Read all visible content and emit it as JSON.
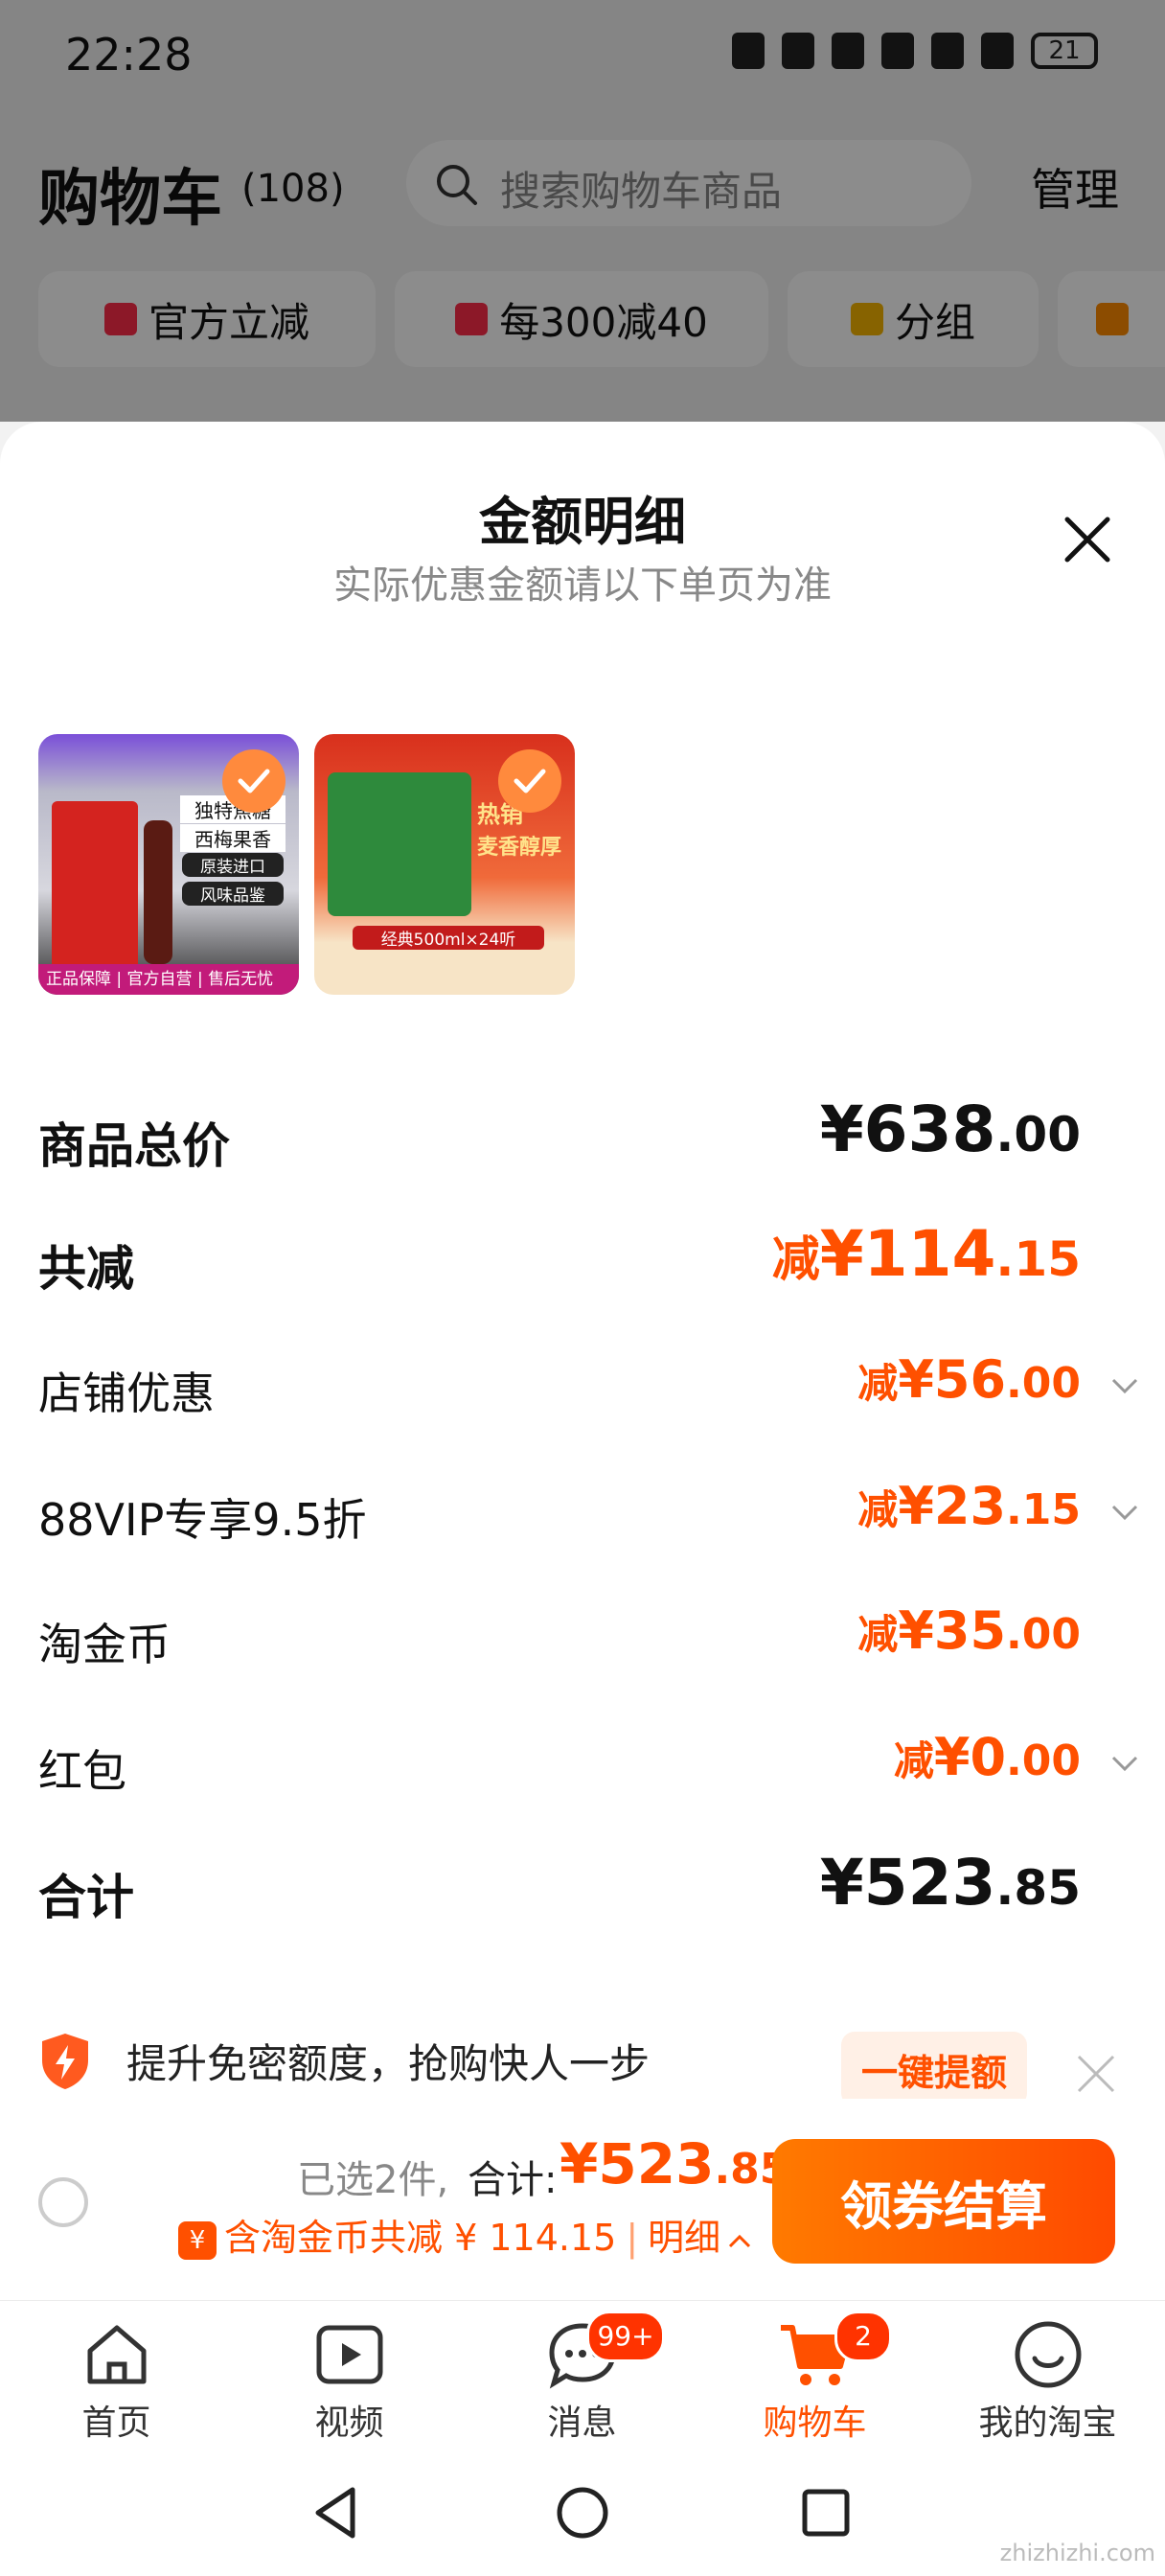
{
  "status_bar": {
    "time": "22:28",
    "battery": "21"
  },
  "header": {
    "title": "购物车",
    "count": "(108)",
    "search_placeholder": "搜索购物车商品",
    "manage": "管理"
  },
  "chips": [
    {
      "label": "官方立减",
      "icon": "lightning-icon"
    },
    {
      "label": "每300减40",
      "icon": "coupon-icon"
    },
    {
      "label": "分组",
      "icon": "folder-icon"
    }
  ],
  "sheet": {
    "title": "金额明细",
    "subtitle": "实际优惠金额请以下单页为准",
    "products": [
      {
        "name": "hennessy-product",
        "tags": [
          "独特焦糖",
          "西梅果香",
          "原装进口",
          "风味品鉴"
        ],
        "footer": "正品保障 | 官方自营 | 售后无忧"
      },
      {
        "name": "tsingtao-product",
        "tags": [
          "热销",
          "麦香醇厚"
        ],
        "footer": "经典500ml×24听"
      }
    ],
    "rows": [
      {
        "label": "商品总价",
        "prefix": "",
        "int": "¥638",
        "dec": ".00",
        "emph": true,
        "orange": false,
        "chevron": false
      },
      {
        "label": "共减",
        "prefix": "减",
        "int": "¥114",
        "dec": ".15",
        "emph": true,
        "orange": true,
        "chevron": false
      },
      {
        "label": "店铺优惠",
        "prefix": "减",
        "int": "¥56",
        "dec": ".00",
        "emph": false,
        "orange": true,
        "chevron": true
      },
      {
        "label": "88VIP专享9.5折",
        "prefix": "减",
        "int": "¥23",
        "dec": ".15",
        "emph": false,
        "orange": true,
        "chevron": true
      },
      {
        "label": "淘金币",
        "prefix": "减",
        "int": "¥35",
        "dec": ".00",
        "emph": false,
        "orange": true,
        "chevron": false
      },
      {
        "label": "红包",
        "prefix": "减",
        "int": "¥0",
        "dec": ".00",
        "emph": false,
        "orange": true,
        "chevron": true
      },
      {
        "label": "合计",
        "prefix": "",
        "int": "¥523",
        "dec": ".85",
        "emph": true,
        "orange": false,
        "chevron": false
      }
    ],
    "tip": {
      "text": "提升免密额度，抢购快人一步",
      "button": "一键提额"
    }
  },
  "checkout": {
    "selected": "已选2件,",
    "total_label": "合计:",
    "total_int": "¥523",
    "total_dec": ".85",
    "promo": "含淘金币共减 ¥ 114.15",
    "detail": "明细",
    "pay": "领券结算"
  },
  "tabs": [
    {
      "label": "首页",
      "icon": "home-icon",
      "badge": ""
    },
    {
      "label": "视频",
      "icon": "video-icon",
      "badge": ""
    },
    {
      "label": "消息",
      "icon": "message-icon",
      "badge": "99+"
    },
    {
      "label": "购物车",
      "icon": "cart-icon",
      "badge": "2"
    },
    {
      "label": "我的淘宝",
      "icon": "smile-icon",
      "badge": ""
    }
  ],
  "watermark": "zhizhizhi.com"
}
